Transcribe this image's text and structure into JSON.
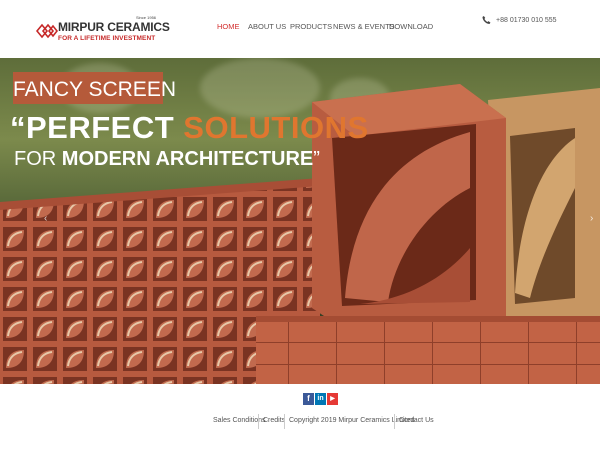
{
  "brand": {
    "since": "Since 1956",
    "name": "MIRPUR CERAMICS",
    "tagline": "FOR A LIFETIME INVESTMENT",
    "accent_color": "#c62828"
  },
  "nav": {
    "items": [
      {
        "label": "HOME",
        "active": true
      },
      {
        "label": "ABOUT US",
        "active": false
      },
      {
        "label": "PRODUCTS",
        "active": false
      },
      {
        "label": "NEWS & EVENTS",
        "active": false
      },
      {
        "label": "DOWNLOAD",
        "active": false
      }
    ]
  },
  "contact": {
    "icon": "phone-icon",
    "phone": "+88 01730 010 555"
  },
  "hero": {
    "label": "FANCY SCREEN",
    "headline_open": "“PERFECT ",
    "headline_accent": "SOLUTIONS",
    "subline_pre": "FOR ",
    "subline_bold": "MODERN ARCHITECTURE",
    "subline_close": "”",
    "label_color": "#b55a3a",
    "accent_color": "#e0762f"
  },
  "social": {
    "facebook": "f",
    "linkedin": "in",
    "youtube": "▶"
  },
  "footer": {
    "links": [
      "Sales Conditions",
      "Credits",
      "Copyright 2019 Mirpur Ceramics Limited",
      "Contact Us"
    ]
  }
}
